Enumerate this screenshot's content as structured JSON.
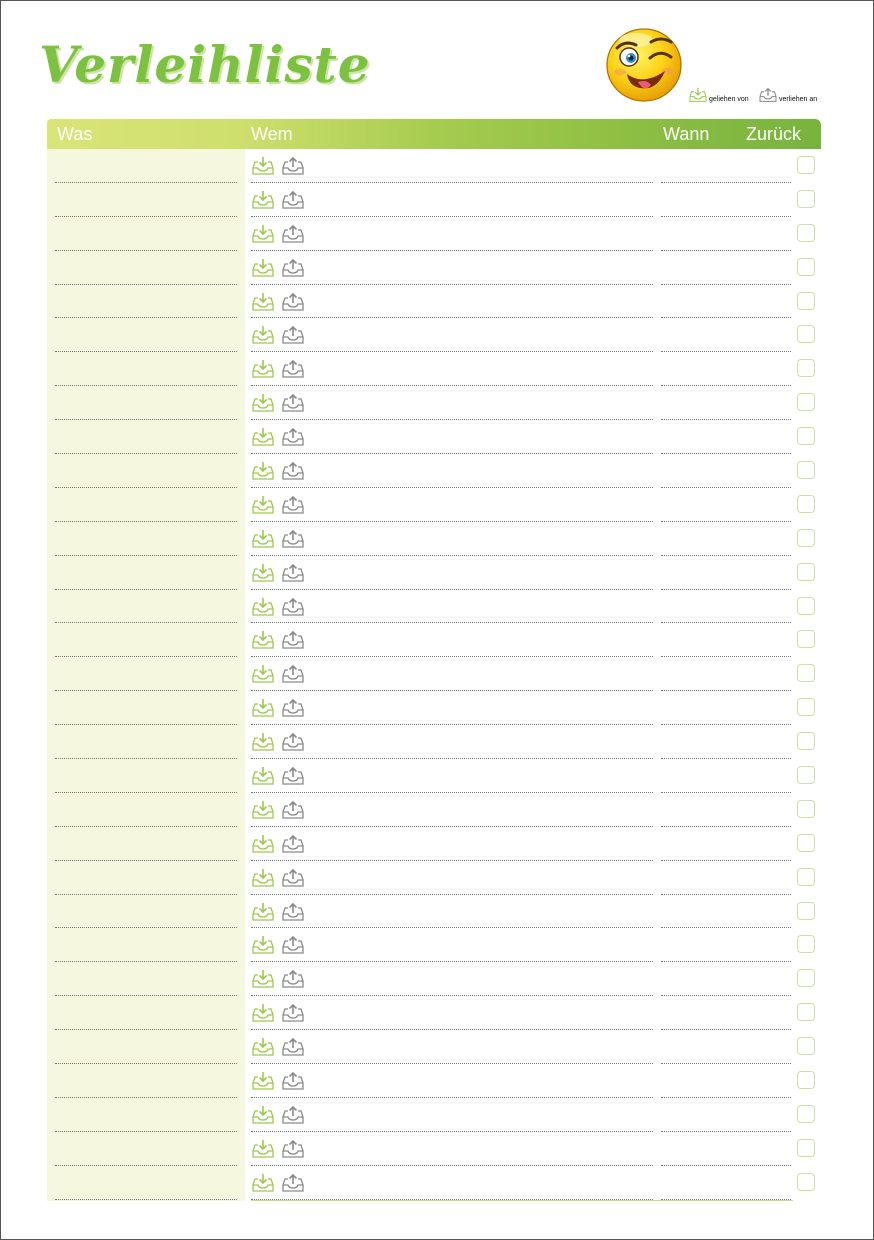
{
  "title": "Verleihliste",
  "legend": {
    "borrowed_from": "geliehen von",
    "lent_to": "verliehen an"
  },
  "columns": {
    "what": "Was",
    "whom": "Wem",
    "when": "Wann",
    "returned": "Zurück"
  },
  "row_count": 31,
  "icons": {
    "smiley": "winking-smiley-icon",
    "borrowed": "inbox-download-icon",
    "lent": "inbox-upload-icon"
  },
  "colors": {
    "accent_green": "#7cc142",
    "header_gradient_start": "#d9e577",
    "header_gradient_end": "#78b33e",
    "was_column_bg": "#f5f8df",
    "icon_in_color": "#9cc94e",
    "icon_out_color": "#8a8a8a"
  }
}
